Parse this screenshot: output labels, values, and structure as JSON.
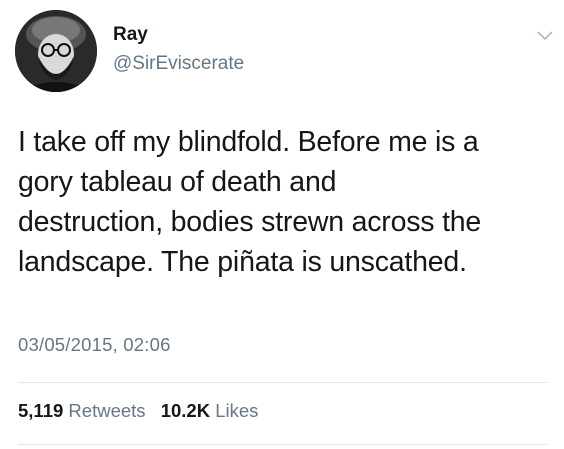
{
  "author": {
    "display_name": "Ray",
    "handle": "@SirEviscerate",
    "avatar_icon": "user-avatar-photo"
  },
  "menu": {
    "icon": "chevron-down-icon"
  },
  "tweet": {
    "lines": [
      "I take off my blindfold. Before me is a",
      "gory tableau of death and",
      "destruction, bodies strewn across the",
      "landscape. The piñata is unscathed."
    ],
    "timestamp": "03/05/2015, 02:06"
  },
  "stats": {
    "retweets_count": "5,119",
    "retweets_label": "Retweets",
    "likes_count": "10.2K",
    "likes_label": "Likes"
  },
  "colors": {
    "text_primary": "#14171a",
    "text_secondary": "#657786",
    "divider": "#e1e8ed",
    "background": "#ffffff"
  }
}
